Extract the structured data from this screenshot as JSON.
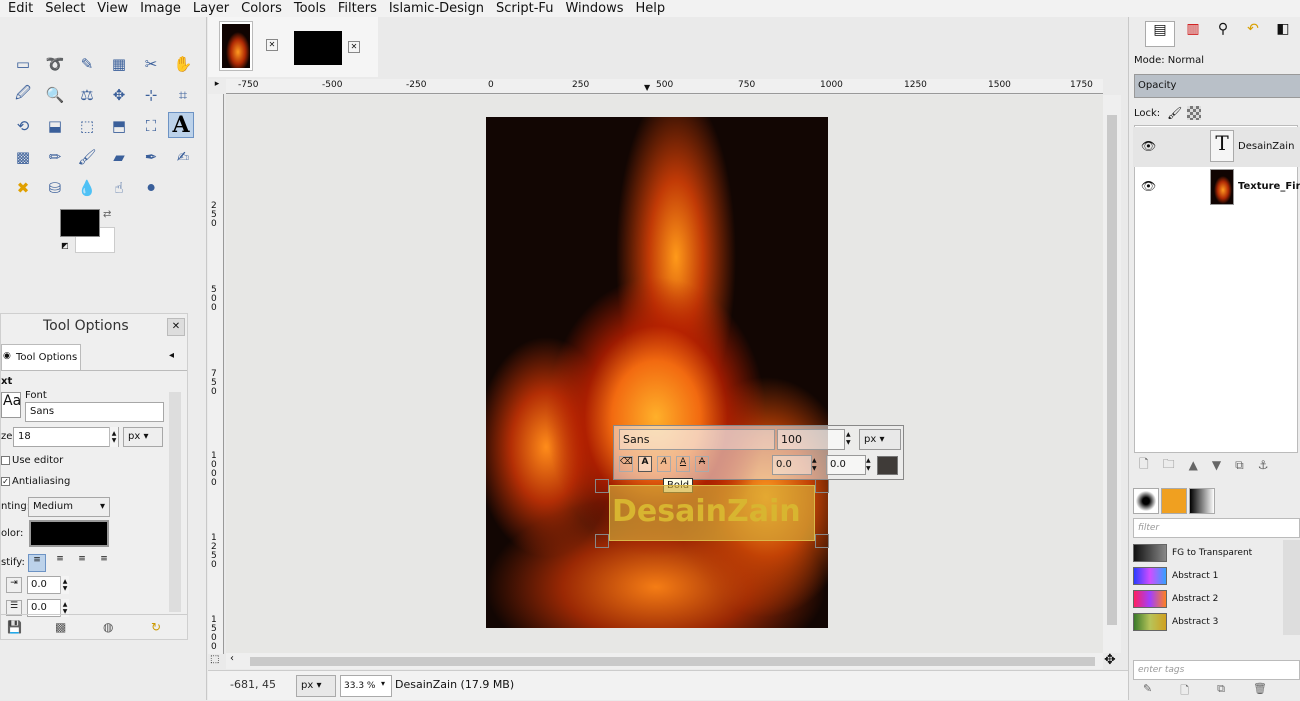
{
  "menu": [
    "Edit",
    "Select",
    "View",
    "Image",
    "Layer",
    "Colors",
    "Tools",
    "Filters",
    "Islamic-Design",
    "Script-Fu",
    "Windows",
    "Help"
  ],
  "image_tabs": [
    {
      "name": "fire-thumbnail"
    },
    {
      "name": "black-thumbnail"
    }
  ],
  "ruler_h_ticks": [
    "-750",
    "-500",
    "-250",
    "0",
    "250",
    "500",
    "750",
    "1000",
    "1250",
    "1500",
    "1750"
  ],
  "ruler_v_ticks": [
    "250",
    "500",
    "750",
    "1000",
    "1250",
    "1500"
  ],
  "tool_options": {
    "title": "Tool Options",
    "tab_label": "Tool Options",
    "section": "xt",
    "font_label": "Font",
    "font_value": "Sans",
    "aa_label": "Aa",
    "size_label": "ze:",
    "size_value": "18",
    "size_unit": "px",
    "use_editor_label": "Use editor",
    "antialiasing_label": "Antialiasing",
    "hinting_label": "nting:",
    "hinting_value": "Medium",
    "color_label": "olor:",
    "justify_label": "stify:",
    "indent_value": "0.0",
    "line_spacing_value": "0.0"
  },
  "text_style_editor": {
    "font": "Sans",
    "size": "100",
    "unit": "px",
    "baseline": "0.0",
    "kerning": "0.0",
    "tooltip": "Bold"
  },
  "text_layer_content": "DesainZain",
  "status": {
    "coords": "-681, 45",
    "unit": "px",
    "zoom": "33.3 %",
    "info": "DesainZain (17.9 MB)"
  },
  "layers_panel": {
    "mode_label": "Mode: Normal",
    "opacity_label": "Opacity",
    "lock_label": "Lock:",
    "layers": [
      {
        "name": "DesainZain",
        "type": "text"
      },
      {
        "name": "Texture_Fire.j",
        "type": "image"
      }
    ]
  },
  "gradients_panel": {
    "filter_placeholder": "filter",
    "tags_placeholder": "enter tags",
    "items": [
      {
        "name": "FG to Transparent",
        "colors": [
          "#111111",
          "#888888"
        ]
      },
      {
        "name": "Abstract 1",
        "colors": [
          "#2a3cff",
          "#d14dff",
          "#35a0ff"
        ]
      },
      {
        "name": "Abstract 2",
        "colors": [
          "#ff2060",
          "#a040ff",
          "#ff8020"
        ]
      },
      {
        "name": "Abstract 3",
        "colors": [
          "#3b7a2a",
          "#b7c45a",
          "#d0a020"
        ]
      }
    ]
  },
  "colors": {
    "accent": "#6d93c4",
    "fg_color": "#000000",
    "bg_color": "#ffffff",
    "text_color": "#d9b84a"
  }
}
